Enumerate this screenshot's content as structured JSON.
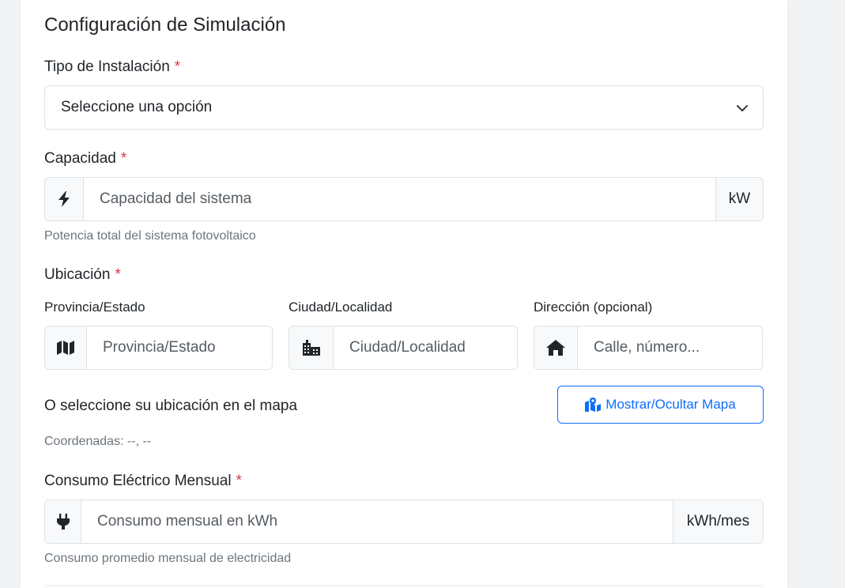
{
  "form": {
    "title": "Configuración de Simulación",
    "required_mark": "*",
    "installation": {
      "label": "Tipo de Instalación",
      "selected": "Seleccione una opción"
    },
    "capacity": {
      "label": "Capacidad",
      "placeholder": "Capacidad del sistema",
      "unit": "kW",
      "help": "Potencia total del sistema fotovoltaico",
      "icon": "bolt-icon"
    },
    "location": {
      "label": "Ubicación",
      "province": {
        "label": "Provincia/Estado",
        "placeholder": "Provincia/Estado",
        "icon": "map-icon"
      },
      "city": {
        "label": "Ciudad/Localidad",
        "placeholder": "Ciudad/Localidad",
        "icon": "city-icon"
      },
      "address": {
        "label": "Dirección (opcional)",
        "placeholder": "Calle, número...",
        "icon": "home-icon"
      },
      "map_prompt": "O seleccione su ubicación en el mapa",
      "map_button": "Mostrar/Ocultar Mapa",
      "coordinates": "Coordenadas: --, --"
    },
    "consumption": {
      "label": "Consumo Eléctrico Mensual",
      "placeholder": "Consumo mensual en kWh",
      "unit": "kWh/mes",
      "help": "Consumo promedio mensual de electricidad",
      "icon": "plug-icon"
    }
  },
  "colors": {
    "primary": "#0d6efd",
    "required": "#dc3545",
    "muted": "#6c757d",
    "border": "#dee2e6",
    "addon_bg": "#f8f9fa"
  }
}
